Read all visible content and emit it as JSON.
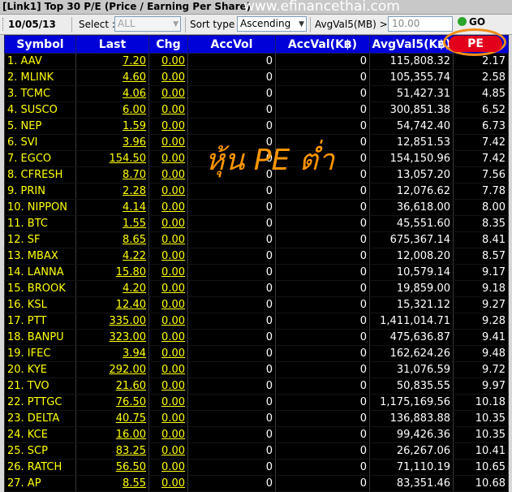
{
  "window": {
    "title": "[Link1] Top 30 P/E (Price / Earning Per Share)",
    "watermark": "www.efinancethai.com"
  },
  "toolbar": {
    "date": "10/05/13",
    "select_label": "Select :",
    "select_value": "ALL",
    "sort_label": "Sort type :",
    "sort_value": "Ascending",
    "avg_label": "AvgVal5(MB) >=",
    "avg_value": "10.00",
    "go_label": "GO"
  },
  "table": {
    "headers": [
      "Symbol",
      "Last",
      "Chg",
      "AccVol",
      "AccVal(K฿)",
      "AvgVal5(K฿)",
      "PE"
    ],
    "rows": [
      {
        "symbol": "1. AAV",
        "last": "7.20",
        "chg": "0.00",
        "accvol": "0",
        "accval": "0",
        "avgval5": "115,808.32",
        "pe": "2.17"
      },
      {
        "symbol": "2. MLINK",
        "last": "4.60",
        "chg": "0.00",
        "accvol": "0",
        "accval": "0",
        "avgval5": "105,355.74",
        "pe": "2.58"
      },
      {
        "symbol": "3. TCMC",
        "last": "4.06",
        "chg": "0.00",
        "accvol": "0",
        "accval": "0",
        "avgval5": "51,427.31",
        "pe": "4.85"
      },
      {
        "symbol": "4. SUSCO",
        "last": "6.00",
        "chg": "0.00",
        "accvol": "0",
        "accval": "0",
        "avgval5": "300,851.38",
        "pe": "6.52"
      },
      {
        "symbol": "5. NEP",
        "last": "1.59",
        "chg": "0.00",
        "accvol": "0",
        "accval": "0",
        "avgval5": "54,742.40",
        "pe": "6.73"
      },
      {
        "symbol": "6. SVI",
        "last": "3.96",
        "chg": "0.00",
        "accvol": "0",
        "accval": "0",
        "avgval5": "12,851.53",
        "pe": "7.42"
      },
      {
        "symbol": "7. EGCO",
        "last": "154.50",
        "chg": "0.00",
        "accvol": "0",
        "accval": "0",
        "avgval5": "154,150.96",
        "pe": "7.42"
      },
      {
        "symbol": "8. CFRESH",
        "last": "8.70",
        "chg": "0.00",
        "accvol": "0",
        "accval": "0",
        "avgval5": "13,057.20",
        "pe": "7.56"
      },
      {
        "symbol": "9. PRIN",
        "last": "2.28",
        "chg": "0.00",
        "accvol": "0",
        "accval": "0",
        "avgval5": "12,076.62",
        "pe": "7.78"
      },
      {
        "symbol": "10. NIPPON",
        "last": "4.14",
        "chg": "0.00",
        "accvol": "0",
        "accval": "0",
        "avgval5": "36,618.00",
        "pe": "8.00"
      },
      {
        "symbol": "11. BTC",
        "last": "1.55",
        "chg": "0.00",
        "accvol": "0",
        "accval": "0",
        "avgval5": "45,551.60",
        "pe": "8.35"
      },
      {
        "symbol": "12. SF",
        "last": "8.65",
        "chg": "0.00",
        "accvol": "0",
        "accval": "0",
        "avgval5": "675,367.14",
        "pe": "8.41"
      },
      {
        "symbol": "13. MBAX",
        "last": "4.22",
        "chg": "0.00",
        "accvol": "0",
        "accval": "0",
        "avgval5": "12,008.20",
        "pe": "8.57"
      },
      {
        "symbol": "14. LANNA",
        "last": "15.80",
        "chg": "0.00",
        "accvol": "0",
        "accval": "0",
        "avgval5": "10,579.14",
        "pe": "9.17"
      },
      {
        "symbol": "15. BROOK",
        "last": "4.20",
        "chg": "0.00",
        "accvol": "0",
        "accval": "0",
        "avgval5": "19,859.00",
        "pe": "9.18"
      },
      {
        "symbol": "16. KSL",
        "last": "12.40",
        "chg": "0.00",
        "accvol": "0",
        "accval": "0",
        "avgval5": "15,321.12",
        "pe": "9.27"
      },
      {
        "symbol": "17. PTT",
        "last": "335.00",
        "chg": "0.00",
        "accvol": "0",
        "accval": "0",
        "avgval5": "1,411,014.71",
        "pe": "9.28"
      },
      {
        "symbol": "18. BANPU",
        "last": "323.00",
        "chg": "0.00",
        "accvol": "0",
        "accval": "0",
        "avgval5": "475,636.87",
        "pe": "9.41"
      },
      {
        "symbol": "19. IFEC",
        "last": "3.94",
        "chg": "0.00",
        "accvol": "0",
        "accval": "0",
        "avgval5": "162,624.26",
        "pe": "9.48"
      },
      {
        "symbol": "20. KYE",
        "last": "292.00",
        "chg": "0.00",
        "accvol": "0",
        "accval": "0",
        "avgval5": "31,076.59",
        "pe": "9.72"
      },
      {
        "symbol": "21. TVO",
        "last": "21.60",
        "chg": "0.00",
        "accvol": "0",
        "accval": "0",
        "avgval5": "50,835.55",
        "pe": "9.97"
      },
      {
        "symbol": "22. PTTGC",
        "last": "76.50",
        "chg": "0.00",
        "accvol": "0",
        "accval": "0",
        "avgval5": "1,175,169.56",
        "pe": "10.18"
      },
      {
        "symbol": "23. DELTA",
        "last": "40.75",
        "chg": "0.00",
        "accvol": "0",
        "accval": "0",
        "avgval5": "136,883.88",
        "pe": "10.35"
      },
      {
        "symbol": "24. KCE",
        "last": "16.00",
        "chg": "0.00",
        "accvol": "0",
        "accval": "0",
        "avgval5": "99,426.36",
        "pe": "10.35"
      },
      {
        "symbol": "25. SCP",
        "last": "83.25",
        "chg": "0.00",
        "accvol": "0",
        "accval": "0",
        "avgval5": "26,267.06",
        "pe": "10.41"
      },
      {
        "symbol": "26. RATCH",
        "last": "56.50",
        "chg": "0.00",
        "accvol": "0",
        "accval": "0",
        "avgval5": "71,110.19",
        "pe": "10.65"
      },
      {
        "symbol": "27. AP",
        "last": "8.55",
        "chg": "0.00",
        "accvol": "0",
        "accval": "0",
        "avgval5": "83,351.46",
        "pe": "10.68"
      }
    ]
  },
  "overlay_text": "หุ้น PE ต่ำ",
  "colors": {
    "header_bg": "#0000d8",
    "symbol_text": "#ffff00",
    "value_text": "#ffffff",
    "pe_badge": "#e3001a",
    "highlight_ring": "#f08c1a",
    "overlay_text": "#ff9600"
  },
  "icons": {
    "go": "green-circle-icon",
    "dropdown": "chevron-down-icon"
  }
}
